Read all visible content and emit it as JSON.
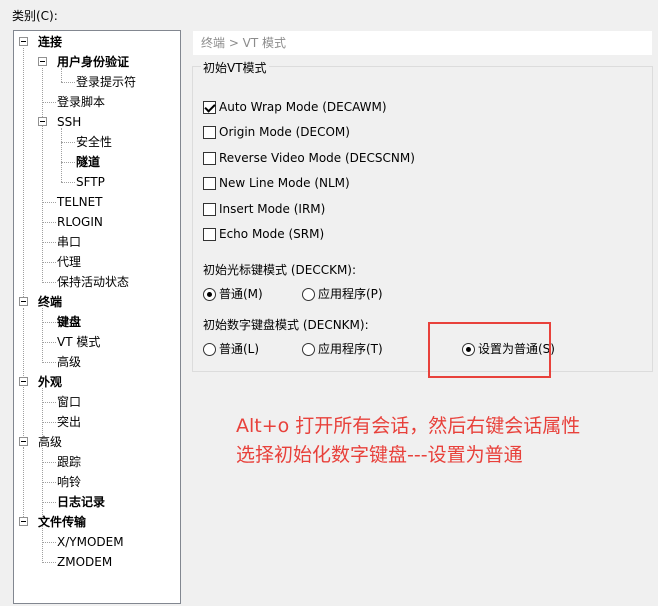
{
  "category_label": "类别(C):",
  "tree": {
    "connection": "连接",
    "auth": "用户身份验证",
    "login_prompt": "登录提示符",
    "login_script": "登录脚本",
    "ssh": "SSH",
    "security": "安全性",
    "tunnel": "隧道",
    "sftp": "SFTP",
    "telnet": "TELNET",
    "rlogin": "RLOGIN",
    "serial": "串口",
    "proxy": "代理",
    "keepalive": "保持活动状态",
    "terminal": "终端",
    "keyboard": "键盘",
    "vt_mode": "VT 模式",
    "advanced": "高级",
    "appearance": "外观",
    "window": "窗口",
    "highlight": "突出",
    "advanced2": "高级",
    "trace": "跟踪",
    "bell": "响铃",
    "log": "日志记录",
    "file_transfer": "文件传输",
    "xymodem": "X/YMODEM",
    "zmodem": "ZMODEM"
  },
  "breadcrumb": "终端 > VT 模式",
  "initial_vt": {
    "title": "初始VT模式",
    "options": [
      {
        "label": "Auto Wrap Mode (DECAWM)",
        "checked": true
      },
      {
        "label": "Origin Mode (DECOM)",
        "checked": false
      },
      {
        "label": "Reverse Video Mode (DECSCNM)",
        "checked": false
      },
      {
        "label": "New Line Mode (NLM)",
        "checked": false
      },
      {
        "label": "Insert Mode (IRM)",
        "checked": false
      },
      {
        "label": "Echo Mode (SRM)",
        "checked": false
      }
    ]
  },
  "cursor_keys": {
    "label": "初始光标键模式 (DECCKM):",
    "normal": "普通(M)",
    "application": "应用程序(P)",
    "selected": "normal"
  },
  "keypad": {
    "label": "初始数字键盘模式 (DECNKM):",
    "normal": "普通(L)",
    "application": "应用程序(T)",
    "set_normal": "设置为普通(S)",
    "selected": "set_normal"
  },
  "annotation": {
    "line1": "Alt+o 打开所有会话，然后右键会话属性",
    "line2": "选择初始化数字键盘---设置为普通"
  },
  "colors": {
    "annotation": "#e8413b",
    "tree_border": "#828790",
    "window_bg": "#f0f0f0"
  }
}
